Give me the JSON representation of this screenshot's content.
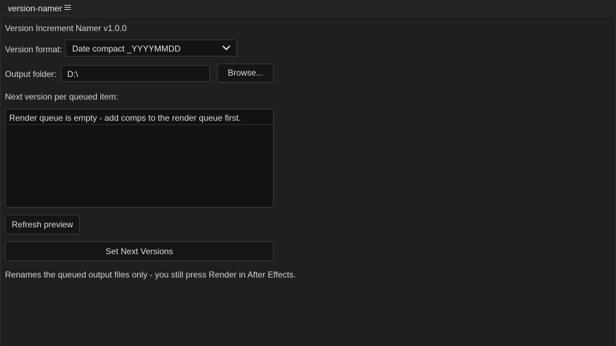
{
  "panel": {
    "tab_title": "version-namer",
    "menu_icon": "hamburger-menu-icon"
  },
  "main": {
    "title": "Version Increment Namer v1.0.0",
    "version_format_label": "Version format:",
    "version_format_value": "Date compact  _YYYYMMDD",
    "dropdown_icon": "chevron-down-icon",
    "output_folder_label": "Output folder:",
    "output_folder_value": "D:\\",
    "browse_label": "Browse...",
    "queue_label": "Next version per queued item:",
    "queue_items": [
      "Render queue is empty - add comps to the render queue first."
    ],
    "refresh_label": "Refresh preview",
    "set_versions_label": "Set Next Versions",
    "footer_note": "Renames the queued output files only - you still press Render in After Effects."
  }
}
